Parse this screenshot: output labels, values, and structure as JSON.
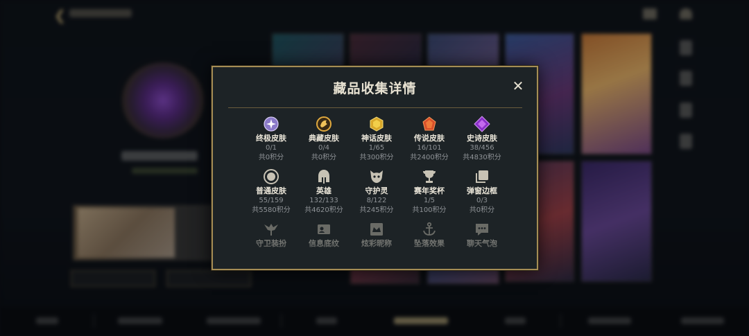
{
  "modal": {
    "title": "藏品收集详情",
    "close_glyph": "✕"
  },
  "categories": [
    {
      "label": "终极皮肤",
      "count": "0/1",
      "points": "共0积分",
      "icon": "ultimate-skin-icon",
      "color": "#b8a4e8"
    },
    {
      "label": "典藏皮肤",
      "count": "0/4",
      "points": "共0积分",
      "icon": "collector-skin-icon",
      "color": "#d8a544"
    },
    {
      "label": "神话皮肤",
      "count": "1/65",
      "points": "共300积分",
      "icon": "mythic-skin-icon",
      "color": "#e2b93a"
    },
    {
      "label": "传说皮肤",
      "count": "16/101",
      "points": "共2400积分",
      "icon": "legendary-skin-icon",
      "color": "#e2642c"
    },
    {
      "label": "史诗皮肤",
      "count": "38/456",
      "points": "共4830积分",
      "icon": "epic-skin-icon",
      "color": "#9c3fd6"
    },
    {
      "label": "普通皮肤",
      "count": "55/159",
      "points": "共5580积分",
      "icon": "normal-skin-icon",
      "color": "#c7c2b4"
    },
    {
      "label": "英雄",
      "count": "132/133",
      "points": "共4620积分",
      "icon": "hero-helmet-icon",
      "color": "#c7c2b4"
    },
    {
      "label": "守护灵",
      "count": "8/122",
      "points": "共245积分",
      "icon": "guardian-spirit-icon",
      "color": "#c7c2b4"
    },
    {
      "label": "赛年奖杯",
      "count": "1/5",
      "points": "共100积分",
      "icon": "trophy-icon",
      "color": "#c7c2b4"
    },
    {
      "label": "弹窗边框",
      "count": "0/3",
      "points": "共0积分",
      "icon": "popup-frame-icon",
      "color": "#c7c2b4"
    },
    {
      "label": "守卫装扮",
      "icon": "ward-skin-icon",
      "color": "#c7c2b4"
    },
    {
      "label": "信息底纹",
      "icon": "info-card-icon",
      "color": "#c7c2b4"
    },
    {
      "label": "炫彩昵称",
      "icon": "colorful-name-icon",
      "color": "#c7c2b4"
    },
    {
      "label": "坠落效果",
      "icon": "anchor-icon",
      "color": "#c7c2b4"
    },
    {
      "label": "聊天气泡",
      "icon": "chat-bubble-icon",
      "color": "#c7c2b4"
    }
  ],
  "theme": {
    "accent_gold": "#a58d55",
    "panel_bg": "#1d2326"
  }
}
